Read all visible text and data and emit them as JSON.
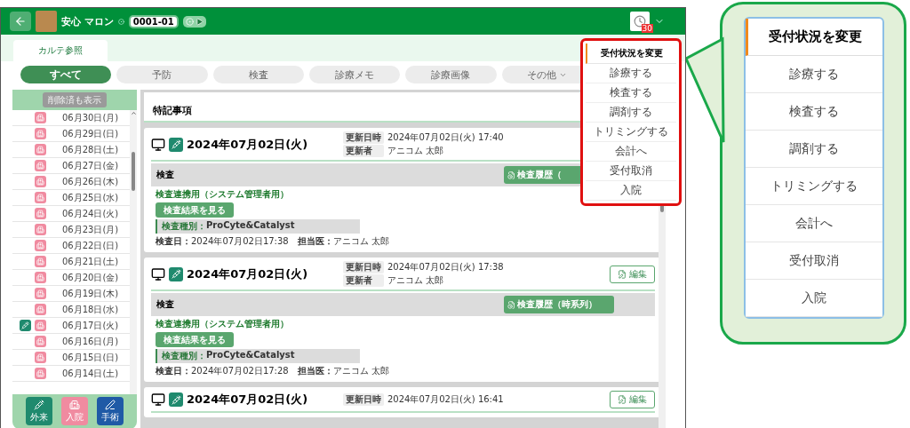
{
  "header": {
    "patient_name": "安心 マロン",
    "patient_id": "0001-01",
    "notification_count": "30"
  },
  "tabs": [
    {
      "label": "カルテ参照",
      "selected": true
    }
  ],
  "filters": [
    {
      "label": "すべて",
      "selected": true,
      "kind": "plain"
    },
    {
      "label": "予防",
      "selected": false,
      "kind": "plain"
    },
    {
      "label": "検査",
      "selected": false,
      "kind": "plain"
    },
    {
      "label": "診療メモ",
      "selected": false,
      "kind": "plain"
    },
    {
      "label": "診療画像",
      "selected": false,
      "kind": "plain"
    },
    {
      "label": "その他",
      "selected": false,
      "kind": "dropdown"
    }
  ],
  "sidebar": {
    "toggle": {
      "label": "削除済も表示",
      "disabled": true
    },
    "items": [
      {
        "date": "06月30日(月)",
        "outpatient": false
      },
      {
        "date": "06月29日(日)",
        "outpatient": false
      },
      {
        "date": "06月28日(土)",
        "outpatient": false
      },
      {
        "date": "06月27日(金)",
        "outpatient": false
      },
      {
        "date": "06月26日(木)",
        "outpatient": false
      },
      {
        "date": "06月25日(水)",
        "outpatient": false
      },
      {
        "date": "06月24日(火)",
        "outpatient": false
      },
      {
        "date": "06月23日(月)",
        "outpatient": false
      },
      {
        "date": "06月22日(日)",
        "outpatient": false
      },
      {
        "date": "06月21日(土)",
        "outpatient": false
      },
      {
        "date": "06月20日(金)",
        "outpatient": false
      },
      {
        "date": "06月19日(木)",
        "outpatient": false
      },
      {
        "date": "06月18日(水)",
        "outpatient": false
      },
      {
        "date": "06月17日(火)",
        "outpatient": true
      },
      {
        "date": "06月16日(月)",
        "outpatient": false
      },
      {
        "date": "06月15日(日)",
        "outpatient": false
      },
      {
        "date": "06月14日(土)",
        "outpatient": false
      }
    ],
    "buttons": [
      {
        "label": "外来",
        "kind": "outpatient",
        "color": "#1f8a6e"
      },
      {
        "label": "入院",
        "kind": "hospital",
        "color": "#f08ba0"
      },
      {
        "label": "手術",
        "kind": "surgery",
        "color": "#1f5aa6"
      }
    ]
  },
  "notes": {
    "title": "特記事項"
  },
  "records": [
    {
      "date": "2024年07月02日(火)",
      "updated_label": "更新日時",
      "updated": "2024年07月02日(火) 17:40",
      "editor_label": "更新者",
      "editor": "アニコム 太郎",
      "section": "検査",
      "history_button": "検査履歴（",
      "link": "検査連携用（システム管理者用）",
      "result_button": "検査結果を見る",
      "type_label": "検査種別：",
      "type": "ProCyte&Catalyst",
      "detail": "**検査日：**2024年07月02日17:38　**担当医：**アニコム 太郎"
    },
    {
      "date": "2024年07月02日(火)",
      "updated_label": "更新日時",
      "updated": "2024年07月02日(火) 17:38",
      "editor_label": "更新者",
      "editor": "アニコム 太郎",
      "edit_button": "編集",
      "section": "検査",
      "history_button": "検査履歴（時系列）",
      "link": "検査連携用（システム管理者用）",
      "result_button": "検査結果を見る",
      "type_label": "検査種別：",
      "type": "ProCyte&Catalyst",
      "detail": "**検査日：**2024年07月02日17:28　**担当医：**アニコム 太郎"
    },
    {
      "date": "2024年07月02日(火)",
      "updated_label": "更新日時",
      "updated": "2024年07月02日(火) 16:41",
      "edit_button": "編集"
    }
  ],
  "status_menu": {
    "title": "受付状況を変更",
    "items": [
      "診療する",
      "検査する",
      "調剤する",
      "トリミングする",
      "会計へ",
      "受付取消",
      "入院"
    ]
  },
  "callout": {
    "title": "受付状況を変更",
    "items": [
      "診療する",
      "検査する",
      "調剤する",
      "トリミングする",
      "会計へ",
      "受付取消",
      "入院"
    ]
  }
}
